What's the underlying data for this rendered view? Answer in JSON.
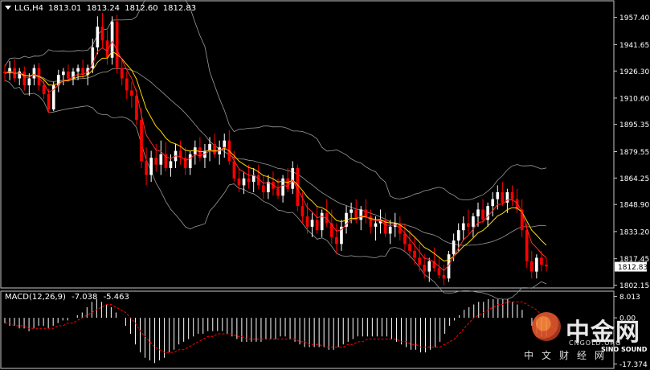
{
  "header": {
    "symbol": "LLG,H4",
    "open": "1813.01",
    "high": "1813.24",
    "low": "1812.60",
    "close": "1812.83"
  },
  "price_axis": {
    "ticks": [
      "1957.40",
      "1941.65",
      "1926.30",
      "1910.60",
      "1895.35",
      "1879.55",
      "1864.25",
      "1848.90",
      "1833.20",
      "1817.45",
      "1802.15"
    ],
    "current": "1812.83",
    "range": [
      1800.5,
      1967.0
    ]
  },
  "macd_header": {
    "label": "MACD(12,26,9)",
    "macd": "-7.038",
    "signal": "-5.463"
  },
  "macd_axis": {
    "ticks": [
      "8.013",
      "0.00",
      "-17.374"
    ],
    "range": [
      -19.0,
      10.0
    ]
  },
  "watermark": {
    "brand": "中金网",
    "url": "CNGOLD.ORG",
    "sub": "中文财经网",
    "partner": "SINO SOUND"
  },
  "colors": {
    "background": "#000000",
    "bull": "#ffffff",
    "bear": "#ff0000",
    "ma_fast": "#ff2a2a",
    "ma_slow": "#ffd700",
    "bands": "#9a9a9a",
    "macd_hist": "#ffffff",
    "macd_signal": "#ff0000"
  },
  "chart_data": {
    "type": "candlestick",
    "timeframe": "H4",
    "candles": [
      [
        1926,
        1930,
        1920,
        1925
      ],
      [
        1925,
        1932,
        1921,
        1928
      ],
      [
        1928,
        1933,
        1920,
        1922
      ],
      [
        1922,
        1928,
        1918,
        1926
      ],
      [
        1926,
        1929,
        1915,
        1918
      ],
      [
        1918,
        1925,
        1912,
        1922
      ],
      [
        1922,
        1930,
        1918,
        1928
      ],
      [
        1928,
        1931,
        1915,
        1918
      ],
      [
        1918,
        1922,
        1910,
        1913
      ],
      [
        1913,
        1916,
        1902,
        1904
      ],
      [
        1904,
        1920,
        1903,
        1918
      ],
      [
        1918,
        1927,
        1914,
        1924
      ],
      [
        1924,
        1928,
        1918,
        1926
      ],
      [
        1926,
        1930,
        1920,
        1922
      ],
      [
        1922,
        1928,
        1918,
        1926
      ],
      [
        1926,
        1930,
        1921,
        1928
      ],
      [
        1928,
        1933,
        1922,
        1924
      ],
      [
        1924,
        1930,
        1918,
        1928
      ],
      [
        1928,
        1945,
        1925,
        1940
      ],
      [
        1940,
        1958,
        1936,
        1952
      ],
      [
        1952,
        1960,
        1940,
        1944
      ],
      [
        1944,
        1950,
        1930,
        1934
      ],
      [
        1934,
        1958,
        1930,
        1955
      ],
      [
        1955,
        1959,
        1925,
        1928
      ],
      [
        1928,
        1934,
        1918,
        1922
      ],
      [
        1922,
        1926,
        1910,
        1915
      ],
      [
        1915,
        1920,
        1905,
        1912
      ],
      [
        1912,
        1916,
        1895,
        1898
      ],
      [
        1898,
        1905,
        1870,
        1874
      ],
      [
        1874,
        1882,
        1860,
        1866
      ],
      [
        1866,
        1880,
        1862,
        1876
      ],
      [
        1876,
        1884,
        1868,
        1872
      ],
      [
        1872,
        1886,
        1866,
        1878
      ],
      [
        1878,
        1885,
        1868,
        1870
      ],
      [
        1870,
        1878,
        1865,
        1874
      ],
      [
        1874,
        1884,
        1870,
        1880
      ],
      [
        1880,
        1886,
        1872,
        1876
      ],
      [
        1876,
        1882,
        1866,
        1870
      ],
      [
        1870,
        1880,
        1866,
        1878
      ],
      [
        1878,
        1886,
        1872,
        1882
      ],
      [
        1882,
        1888,
        1874,
        1876
      ],
      [
        1876,
        1884,
        1870,
        1880
      ],
      [
        1880,
        1888,
        1874,
        1884
      ],
      [
        1884,
        1890,
        1876,
        1878
      ],
      [
        1878,
        1886,
        1872,
        1882
      ],
      [
        1882,
        1890,
        1876,
        1886
      ],
      [
        1886,
        1892,
        1872,
        1874
      ],
      [
        1874,
        1880,
        1862,
        1864
      ],
      [
        1864,
        1870,
        1856,
        1860
      ],
      [
        1860,
        1868,
        1855,
        1864
      ],
      [
        1864,
        1872,
        1858,
        1862
      ],
      [
        1862,
        1870,
        1856,
        1866
      ],
      [
        1866,
        1872,
        1858,
        1860
      ],
      [
        1860,
        1866,
        1852,
        1856
      ],
      [
        1856,
        1866,
        1852,
        1862
      ],
      [
        1862,
        1868,
        1854,
        1858
      ],
      [
        1858,
        1864,
        1852,
        1854
      ],
      [
        1854,
        1866,
        1850,
        1864
      ],
      [
        1864,
        1870,
        1856,
        1858
      ],
      [
        1858,
        1874,
        1855,
        1870
      ],
      [
        1870,
        1872,
        1845,
        1848
      ],
      [
        1848,
        1856,
        1838,
        1842
      ],
      [
        1842,
        1850,
        1832,
        1836
      ],
      [
        1836,
        1844,
        1830,
        1840
      ],
      [
        1840,
        1848,
        1832,
        1834
      ],
      [
        1834,
        1846,
        1830,
        1844
      ],
      [
        1844,
        1852,
        1836,
        1838
      ],
      [
        1838,
        1846,
        1826,
        1830
      ],
      [
        1830,
        1838,
        1820,
        1826
      ],
      [
        1826,
        1840,
        1822,
        1836
      ],
      [
        1836,
        1848,
        1832,
        1844
      ],
      [
        1844,
        1850,
        1838,
        1846
      ],
      [
        1846,
        1852,
        1838,
        1840
      ],
      [
        1840,
        1848,
        1834,
        1846
      ],
      [
        1846,
        1852,
        1838,
        1842
      ],
      [
        1842,
        1846,
        1832,
        1836
      ],
      [
        1836,
        1842,
        1828,
        1838
      ],
      [
        1838,
        1846,
        1832,
        1840
      ],
      [
        1840,
        1844,
        1830,
        1832
      ],
      [
        1832,
        1840,
        1826,
        1836
      ],
      [
        1836,
        1844,
        1830,
        1838
      ],
      [
        1838,
        1842,
        1828,
        1832
      ],
      [
        1832,
        1838,
        1822,
        1826
      ],
      [
        1826,
        1834,
        1818,
        1822
      ],
      [
        1822,
        1830,
        1814,
        1818
      ],
      [
        1818,
        1826,
        1810,
        1814
      ],
      [
        1814,
        1820,
        1806,
        1810
      ],
      [
        1810,
        1818,
        1804,
        1816
      ],
      [
        1816,
        1824,
        1810,
        1812
      ],
      [
        1812,
        1818,
        1806,
        1808
      ],
      [
        1808,
        1814,
        1802,
        1806
      ],
      [
        1806,
        1822,
        1804,
        1820
      ],
      [
        1820,
        1832,
        1816,
        1828
      ],
      [
        1828,
        1838,
        1822,
        1834
      ],
      [
        1834,
        1842,
        1828,
        1838
      ],
      [
        1838,
        1846,
        1832,
        1836
      ],
      [
        1836,
        1844,
        1830,
        1842
      ],
      [
        1842,
        1850,
        1836,
        1846
      ],
      [
        1846,
        1852,
        1838,
        1840
      ],
      [
        1840,
        1850,
        1836,
        1848
      ],
      [
        1848,
        1856,
        1842,
        1852
      ],
      [
        1852,
        1860,
        1846,
        1856
      ],
      [
        1856,
        1862,
        1848,
        1850
      ],
      [
        1850,
        1858,
        1844,
        1856
      ],
      [
        1856,
        1860,
        1848,
        1852
      ],
      [
        1852,
        1858,
        1844,
        1846
      ],
      [
        1846,
        1852,
        1830,
        1834
      ],
      [
        1834,
        1838,
        1812,
        1816
      ],
      [
        1816,
        1822,
        1806,
        1810
      ],
      [
        1810,
        1820,
        1806,
        1818
      ],
      [
        1818,
        1822,
        1810,
        1814
      ],
      [
        1814,
        1818,
        1810,
        1813
      ]
    ],
    "macd_hist": [
      -2,
      -3,
      -3,
      -4,
      -4,
      -5,
      -4,
      -3,
      -3,
      -4,
      -3,
      -2,
      -1,
      -1,
      0,
      1,
      2,
      4,
      6,
      7,
      6,
      5,
      4,
      2,
      0,
      -3,
      -6,
      -10,
      -13,
      -15,
      -16,
      -17,
      -16,
      -15,
      -13,
      -12,
      -10,
      -9,
      -8,
      -7,
      -6,
      -6,
      -5,
      -5,
      -5,
      -5,
      -6,
      -7,
      -8,
      -9,
      -9,
      -9,
      -9,
      -9,
      -8,
      -8,
      -8,
      -7,
      -7,
      -8,
      -9,
      -10,
      -11,
      -11,
      -11,
      -11,
      -11,
      -12,
      -12,
      -11,
      -10,
      -9,
      -8,
      -7,
      -7,
      -7,
      -7,
      -7,
      -7,
      -7,
      -8,
      -9,
      -10,
      -11,
      -12,
      -12,
      -13,
      -13,
      -12,
      -11,
      -9,
      -6,
      -3,
      -1,
      1,
      3,
      4,
      5,
      6,
      6,
      7,
      7,
      7,
      7,
      7,
      6,
      5,
      3,
      0,
      -3,
      -6,
      -7,
      -7
    ],
    "macd_signal": [
      -2,
      -2,
      -3,
      -3,
      -3,
      -4,
      -4,
      -4,
      -4,
      -4,
      -4,
      -3,
      -3,
      -2,
      -2,
      -1,
      0,
      1,
      2,
      3,
      4,
      5,
      5,
      4,
      3,
      2,
      0,
      -2,
      -5,
      -7,
      -9,
      -11,
      -12,
      -13,
      -13,
      -13,
      -12,
      -12,
      -11,
      -10,
      -9,
      -8,
      -7,
      -7,
      -6,
      -6,
      -6,
      -6,
      -7,
      -7,
      -8,
      -8,
      -8,
      -8,
      -8,
      -8,
      -8,
      -8,
      -8,
      -8,
      -8,
      -9,
      -9,
      -10,
      -10,
      -10,
      -11,
      -11,
      -11,
      -11,
      -11,
      -10,
      -10,
      -9,
      -9,
      -8,
      -8,
      -8,
      -8,
      -8,
      -8,
      -8,
      -9,
      -9,
      -10,
      -10,
      -11,
      -11,
      -11,
      -11,
      -11,
      -10,
      -9,
      -8,
      -6,
      -4,
      -2,
      0,
      1,
      2,
      3,
      4,
      5,
      5,
      6,
      6,
      6,
      6,
      5,
      4,
      3,
      1,
      -1,
      -3,
      -5
    ]
  }
}
